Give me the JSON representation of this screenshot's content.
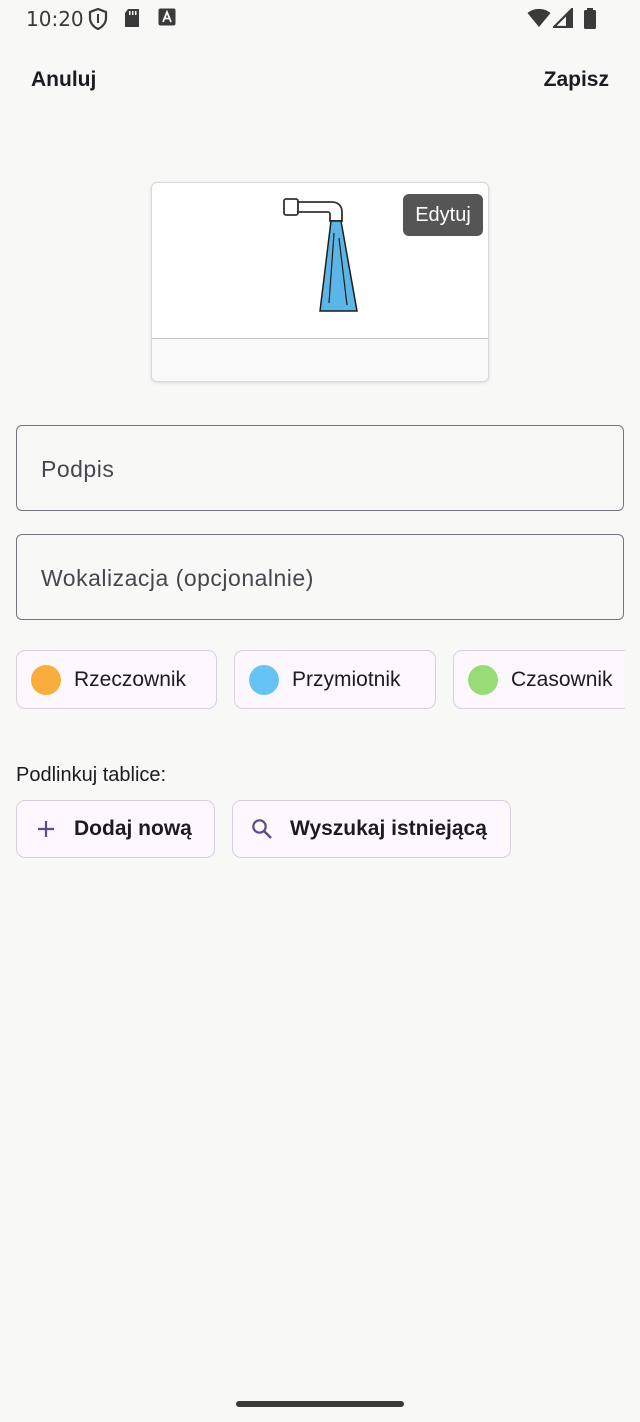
{
  "status_bar": {
    "time": "10:20",
    "icons": [
      "shield-icon",
      "sd-card-icon",
      "font-a-icon",
      "wifi-icon",
      "signal-icon",
      "battery-icon"
    ]
  },
  "top_bar": {
    "cancel_label": "Anuluj",
    "save_label": "Zapisz"
  },
  "tile": {
    "image": "water-tap-icon",
    "edit_label": "Edytuj",
    "label": ""
  },
  "fields": {
    "caption_placeholder": "Podpis",
    "caption_value": "",
    "vocalization_placeholder": "Wokalizacja (opcjonalnie)",
    "vocalization_value": ""
  },
  "categories": [
    {
      "label": "Rzeczownik",
      "color": "#f8ad3d"
    },
    {
      "label": "Przymiotnik",
      "color": "#65c3f5"
    },
    {
      "label": "Czasownik",
      "color": "#98dc78"
    }
  ],
  "link_boards": {
    "label": "Podlinkuj tablice:",
    "add_new_label": "Dodaj nową",
    "search_existing_label": "Wyszukaj istniejącą"
  },
  "colors": {
    "background": "#f8f8f7",
    "chip_border": "#d8cfe0",
    "accent": "#5b4a86"
  }
}
